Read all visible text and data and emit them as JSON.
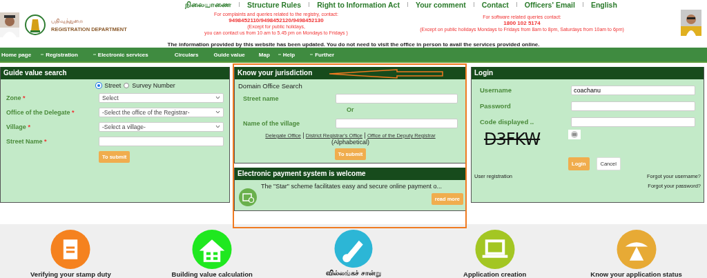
{
  "header": {
    "department_tamil": "பதிவுத்துறை",
    "department": "REGISTRATION DEPARTMENT",
    "top_links": [
      "நிலையாணை",
      "Structure Rules",
      "Right to Information Act",
      "Your comment",
      "Contact",
      "Officers' Email",
      "English"
    ],
    "complaints": {
      "title": "For complaints and queries related to the registry, contact:",
      "phones": "9498452110/9498452120/9498452130",
      "note_1": "(Except for public holidays,",
      "note_2": "you can contact us from 10 am to 5.45 pm on Mondays to Fridays )"
    },
    "software": {
      "title": "For software related queries contact:",
      "phone": "1800 102 5174",
      "note": "(Except on public holidays Mondays to Fridays from 8am to 8pm, Saturdays from 10am to 6pm)"
    }
  },
  "notice": "The information provided by this website has been updated. You do not need to visit the office in person to avail the services provided online.",
  "nav": [
    {
      "label": "Home page",
      "submenu": false
    },
    {
      "label": "Registration",
      "submenu": true
    },
    {
      "label": "Electronic services",
      "submenu": true
    },
    {
      "label": "Circulars",
      "submenu": false
    },
    {
      "label": "Guide value",
      "submenu": false
    },
    {
      "label": "Map",
      "submenu": false
    },
    {
      "label": "Help",
      "submenu": true
    },
    {
      "label": "Further",
      "submenu": true
    }
  ],
  "guide_value": {
    "title": "Guide value search",
    "radios": [
      {
        "label": "Street",
        "selected": true
      },
      {
        "label": "Survey Number",
        "selected": false
      }
    ],
    "fields": [
      {
        "label": "Zone",
        "required_mark": "*",
        "kind": "select",
        "value": "Select"
      },
      {
        "label": "Office of the Delegate",
        "required_mark": "*",
        "kind": "select",
        "value": "-Select the office of the Registrar-"
      },
      {
        "label": "Village",
        "required_mark": "*",
        "kind": "select",
        "value": "-Select a village-"
      },
      {
        "label": "Street Name",
        "required_mark": "*",
        "kind": "text"
      }
    ],
    "submit": "To submit"
  },
  "jurisdiction": {
    "title": "Know your jurisdiction",
    "subtitle": "Domain Office Search",
    "fields": [
      {
        "label": "Street name"
      },
      {
        "label": "Name of the village"
      }
    ],
    "or": "Or",
    "links": [
      "Delegate Office",
      "District Registrar's Office",
      "Office of the Deputy Registrar"
    ],
    "note": "(Alphabetical)",
    "submit": "To submit"
  },
  "payment": {
    "title": "Electronic payment system is welcome",
    "text": "The \"Star\" scheme facilitates easy and secure online payment o...",
    "button": "read more"
  },
  "login": {
    "title": "Login",
    "fields": [
      {
        "label": "Username",
        "value": "coachanu"
      },
      {
        "label": "Password"
      },
      {
        "label": "Code displayed .."
      }
    ],
    "captcha": "D3FKW",
    "login_button": "Login",
    "cancel_button": "Cancel",
    "register": "User registration",
    "forgot": [
      "Forgot your username?",
      "Forgot your password?"
    ]
  },
  "services": [
    {
      "label": "Verifying your stamp duty",
      "color": "#f5821f"
    },
    {
      "label": "Building value calculation",
      "color": "#1fe81f"
    },
    {
      "label": "வில்லங்கச் சான்று",
      "color": "#2cb6d6"
    },
    {
      "label": "Application creation",
      "color": "#a3c623"
    },
    {
      "label": "Know your application status",
      "color": "#e7aa35"
    }
  ]
}
